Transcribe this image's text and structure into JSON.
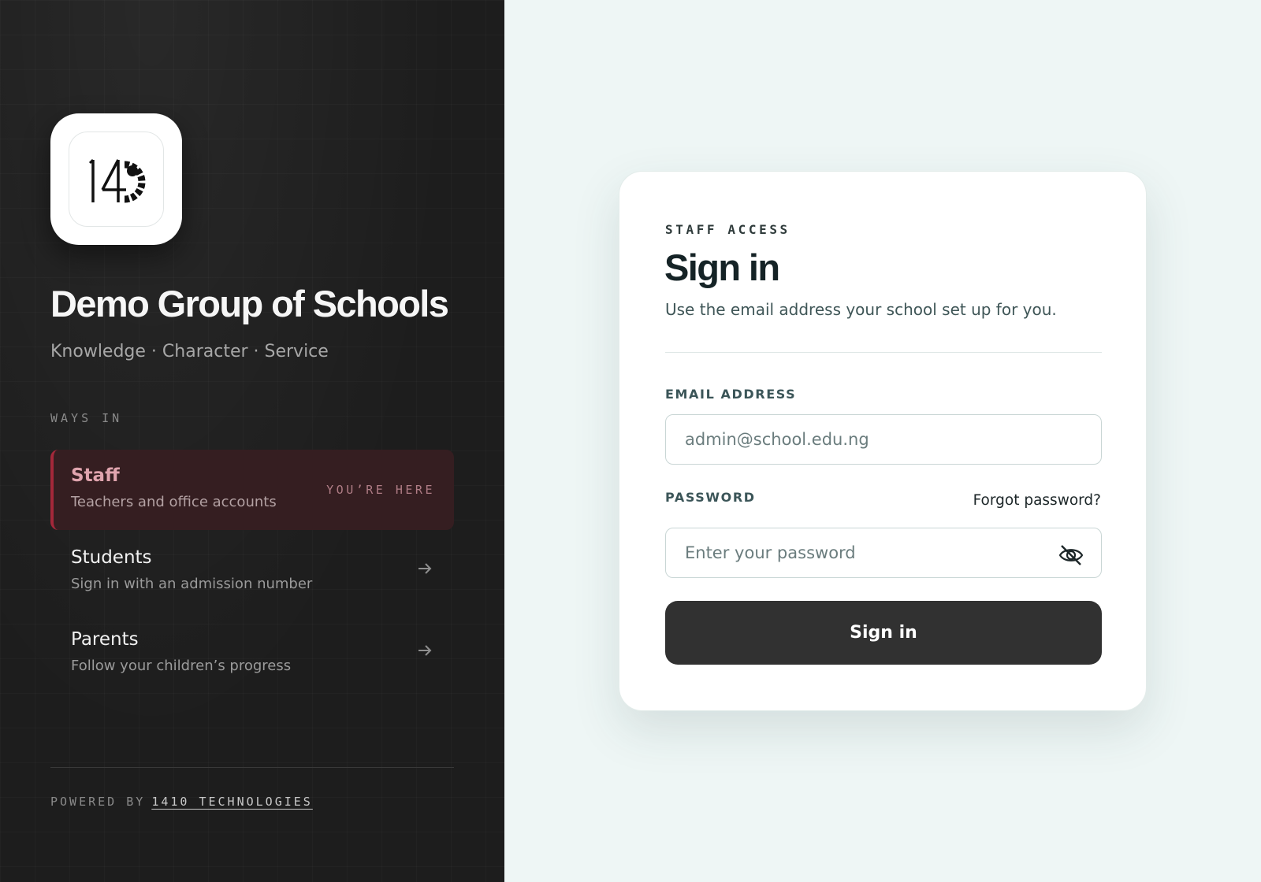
{
  "brand": {
    "school_name": "Demo Group of Schools",
    "motto": "Knowledge · Character · Service",
    "logo_icon": "1410-logo-icon"
  },
  "ways_in": {
    "label": "WAYS IN",
    "items": [
      {
        "title": "Staff",
        "subtitle": "Teachers and office accounts",
        "tag": "YOU’RE HERE",
        "active": true
      },
      {
        "title": "Students",
        "subtitle": "Sign in with an admission number",
        "icon": "arrow-right-icon",
        "active": false
      },
      {
        "title": "Parents",
        "subtitle": "Follow your children’s progress",
        "icon": "arrow-right-icon",
        "active": false
      }
    ]
  },
  "footer": {
    "powered_by": "POWERED BY",
    "company": "1410 TECHNOLOGIES"
  },
  "form": {
    "kicker": "STAFF ACCESS",
    "title": "Sign in",
    "subtitle": "Use the email address your school set up for you.",
    "email_label": "EMAIL ADDRESS",
    "email_placeholder": "admin@school.edu.ng",
    "password_label": "PASSWORD",
    "forgot_label": "Forgot password?",
    "password_placeholder": "Enter your password",
    "toggle_icon": "eye-off-icon",
    "submit_label": "Sign in"
  },
  "colors": {
    "left_bg": "#1d1d1d",
    "accent": "#a3283a",
    "page_bg": "#eef6f5",
    "button_bg": "#313131"
  }
}
